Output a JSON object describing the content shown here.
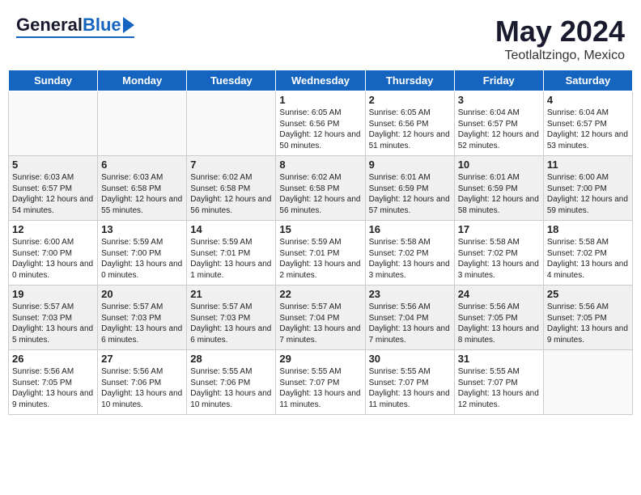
{
  "header": {
    "logo_general": "General",
    "logo_blue": "Blue",
    "month_title": "May 2024",
    "location": "Teotlaltzingo, Mexico"
  },
  "weekdays": [
    "Sunday",
    "Monday",
    "Tuesday",
    "Wednesday",
    "Thursday",
    "Friday",
    "Saturday"
  ],
  "weeks": [
    [
      {
        "day": "",
        "empty": true
      },
      {
        "day": "",
        "empty": true
      },
      {
        "day": "",
        "empty": true
      },
      {
        "day": "1",
        "sunrise": "6:05 AM",
        "sunset": "6:56 PM",
        "daylight": "12 hours and 50 minutes."
      },
      {
        "day": "2",
        "sunrise": "6:05 AM",
        "sunset": "6:56 PM",
        "daylight": "12 hours and 51 minutes."
      },
      {
        "day": "3",
        "sunrise": "6:04 AM",
        "sunset": "6:57 PM",
        "daylight": "12 hours and 52 minutes."
      },
      {
        "day": "4",
        "sunrise": "6:04 AM",
        "sunset": "6:57 PM",
        "daylight": "12 hours and 53 minutes."
      }
    ],
    [
      {
        "day": "5",
        "sunrise": "6:03 AM",
        "sunset": "6:57 PM",
        "daylight": "12 hours and 54 minutes."
      },
      {
        "day": "6",
        "sunrise": "6:03 AM",
        "sunset": "6:58 PM",
        "daylight": "12 hours and 55 minutes."
      },
      {
        "day": "7",
        "sunrise": "6:02 AM",
        "sunset": "6:58 PM",
        "daylight": "12 hours and 56 minutes."
      },
      {
        "day": "8",
        "sunrise": "6:02 AM",
        "sunset": "6:58 PM",
        "daylight": "12 hours and 56 minutes."
      },
      {
        "day": "9",
        "sunrise": "6:01 AM",
        "sunset": "6:59 PM",
        "daylight": "12 hours and 57 minutes."
      },
      {
        "day": "10",
        "sunrise": "6:01 AM",
        "sunset": "6:59 PM",
        "daylight": "12 hours and 58 minutes."
      },
      {
        "day": "11",
        "sunrise": "6:00 AM",
        "sunset": "7:00 PM",
        "daylight": "12 hours and 59 minutes."
      }
    ],
    [
      {
        "day": "12",
        "sunrise": "6:00 AM",
        "sunset": "7:00 PM",
        "daylight": "13 hours and 0 minutes."
      },
      {
        "day": "13",
        "sunrise": "5:59 AM",
        "sunset": "7:00 PM",
        "daylight": "13 hours and 0 minutes."
      },
      {
        "day": "14",
        "sunrise": "5:59 AM",
        "sunset": "7:01 PM",
        "daylight": "13 hours and 1 minute."
      },
      {
        "day": "15",
        "sunrise": "5:59 AM",
        "sunset": "7:01 PM",
        "daylight": "13 hours and 2 minutes."
      },
      {
        "day": "16",
        "sunrise": "5:58 AM",
        "sunset": "7:02 PM",
        "daylight": "13 hours and 3 minutes."
      },
      {
        "day": "17",
        "sunrise": "5:58 AM",
        "sunset": "7:02 PM",
        "daylight": "13 hours and 3 minutes."
      },
      {
        "day": "18",
        "sunrise": "5:58 AM",
        "sunset": "7:02 PM",
        "daylight": "13 hours and 4 minutes."
      }
    ],
    [
      {
        "day": "19",
        "sunrise": "5:57 AM",
        "sunset": "7:03 PM",
        "daylight": "13 hours and 5 minutes."
      },
      {
        "day": "20",
        "sunrise": "5:57 AM",
        "sunset": "7:03 PM",
        "daylight": "13 hours and 6 minutes."
      },
      {
        "day": "21",
        "sunrise": "5:57 AM",
        "sunset": "7:03 PM",
        "daylight": "13 hours and 6 minutes."
      },
      {
        "day": "22",
        "sunrise": "5:57 AM",
        "sunset": "7:04 PM",
        "daylight": "13 hours and 7 minutes."
      },
      {
        "day": "23",
        "sunrise": "5:56 AM",
        "sunset": "7:04 PM",
        "daylight": "13 hours and 7 minutes."
      },
      {
        "day": "24",
        "sunrise": "5:56 AM",
        "sunset": "7:05 PM",
        "daylight": "13 hours and 8 minutes."
      },
      {
        "day": "25",
        "sunrise": "5:56 AM",
        "sunset": "7:05 PM",
        "daylight": "13 hours and 9 minutes."
      }
    ],
    [
      {
        "day": "26",
        "sunrise": "5:56 AM",
        "sunset": "7:05 PM",
        "daylight": "13 hours and 9 minutes."
      },
      {
        "day": "27",
        "sunrise": "5:56 AM",
        "sunset": "7:06 PM",
        "daylight": "13 hours and 10 minutes."
      },
      {
        "day": "28",
        "sunrise": "5:55 AM",
        "sunset": "7:06 PM",
        "daylight": "13 hours and 10 minutes."
      },
      {
        "day": "29",
        "sunrise": "5:55 AM",
        "sunset": "7:07 PM",
        "daylight": "13 hours and 11 minutes."
      },
      {
        "day": "30",
        "sunrise": "5:55 AM",
        "sunset": "7:07 PM",
        "daylight": "13 hours and 11 minutes."
      },
      {
        "day": "31",
        "sunrise": "5:55 AM",
        "sunset": "7:07 PM",
        "daylight": "13 hours and 12 minutes."
      },
      {
        "day": "",
        "empty": true
      }
    ]
  ]
}
